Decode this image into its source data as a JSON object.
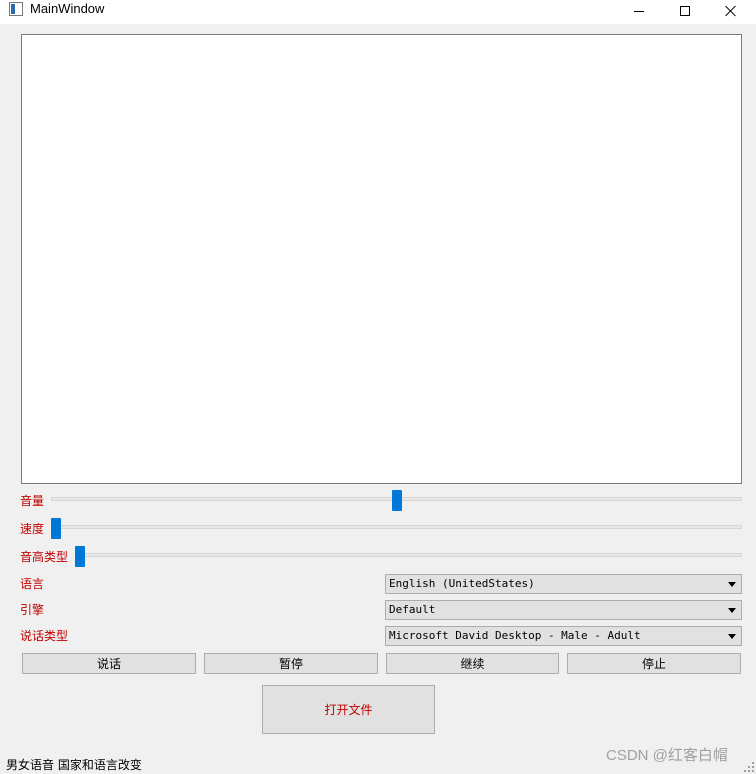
{
  "window": {
    "title": "MainWindow",
    "icons": {
      "app": "window-app-icon",
      "minimize": "minimize-icon",
      "maximize": "maximize-icon",
      "close": "close-icon"
    }
  },
  "controls": {
    "volume": {
      "label": "音量",
      "value": 0.5
    },
    "speed": {
      "label": "速度",
      "value": 0.0
    },
    "pitch": {
      "label": "音高类型",
      "value": 0.0
    }
  },
  "selects": {
    "language": {
      "label": "语言",
      "value": "English (UnitedStates)"
    },
    "engine": {
      "label": "引擎",
      "value": "Default"
    },
    "voice": {
      "label": "说话类型",
      "value": "Microsoft David Desktop - Male - Adult"
    }
  },
  "buttons": {
    "speak": "说话",
    "pause": "暂停",
    "resume": "继续",
    "stop": "停止",
    "open_file": "打开文件"
  },
  "status": {
    "text": "男女语音 国家和语言改变"
  },
  "watermark": "CSDN @红客白帽",
  "colors": {
    "label": "#c00000",
    "slider": "#0078d7"
  }
}
